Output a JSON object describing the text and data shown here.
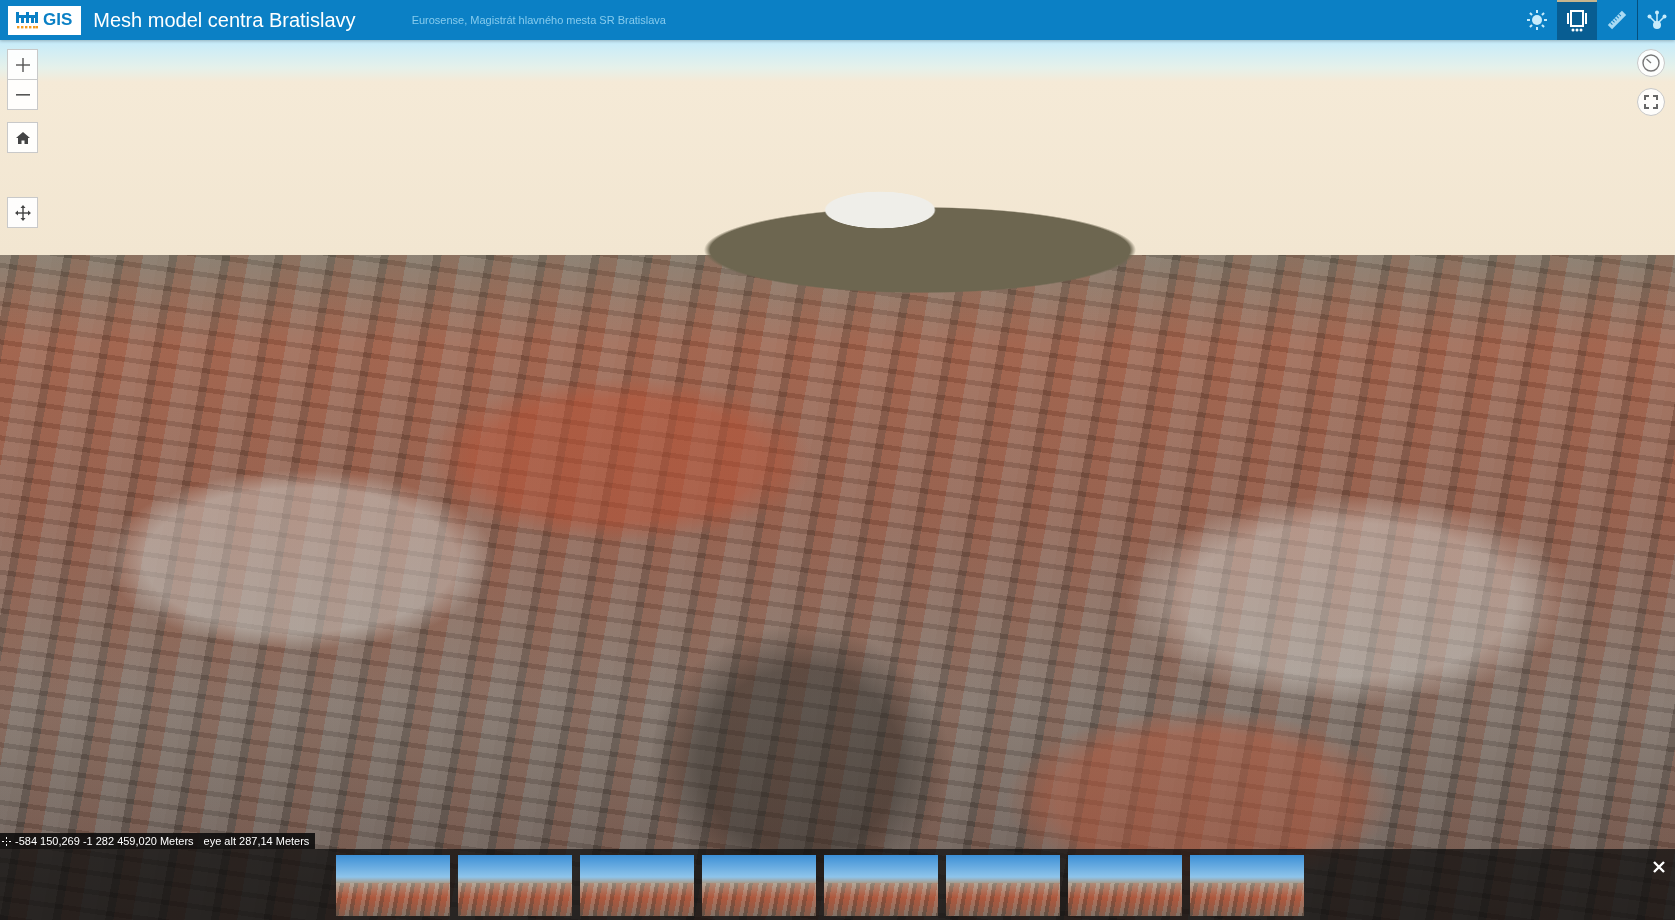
{
  "header": {
    "logo": {
      "text": "GIS"
    },
    "title": "Mesh model centra Bratislavy",
    "credits": "Eurosense, Magistrát hlavného mesta SR Bratislava",
    "tools": [
      {
        "kind": "daylight",
        "selected": false
      },
      {
        "kind": "slides",
        "selected": true
      },
      {
        "kind": "measure",
        "selected": false
      },
      {
        "kind": "share",
        "selected": false
      }
    ]
  },
  "scene": {
    "kind": "mesh"
  },
  "navigation": [
    {
      "kind": "zoom-in"
    },
    {
      "kind": "zoom-out"
    },
    {
      "kind": "home"
    },
    {
      "kind": "pan"
    }
  ],
  "view_controls": [
    {
      "kind": "compass"
    },
    {
      "kind": "fullscreen"
    }
  ],
  "status": {
    "coordinates": "-584 150,269 -1 282 459,020 Meters",
    "altitude": "eye alt 287,14 Meters"
  },
  "slides": {
    "closable": true,
    "items": [
      {
        "kind": "photo"
      },
      {
        "kind": "photo"
      },
      {
        "kind": "photo"
      },
      {
        "kind": "photo"
      },
      {
        "kind": "photo"
      },
      {
        "kind": "photo"
      },
      {
        "kind": "photo"
      },
      {
        "kind": "photo"
      }
    ]
  }
}
